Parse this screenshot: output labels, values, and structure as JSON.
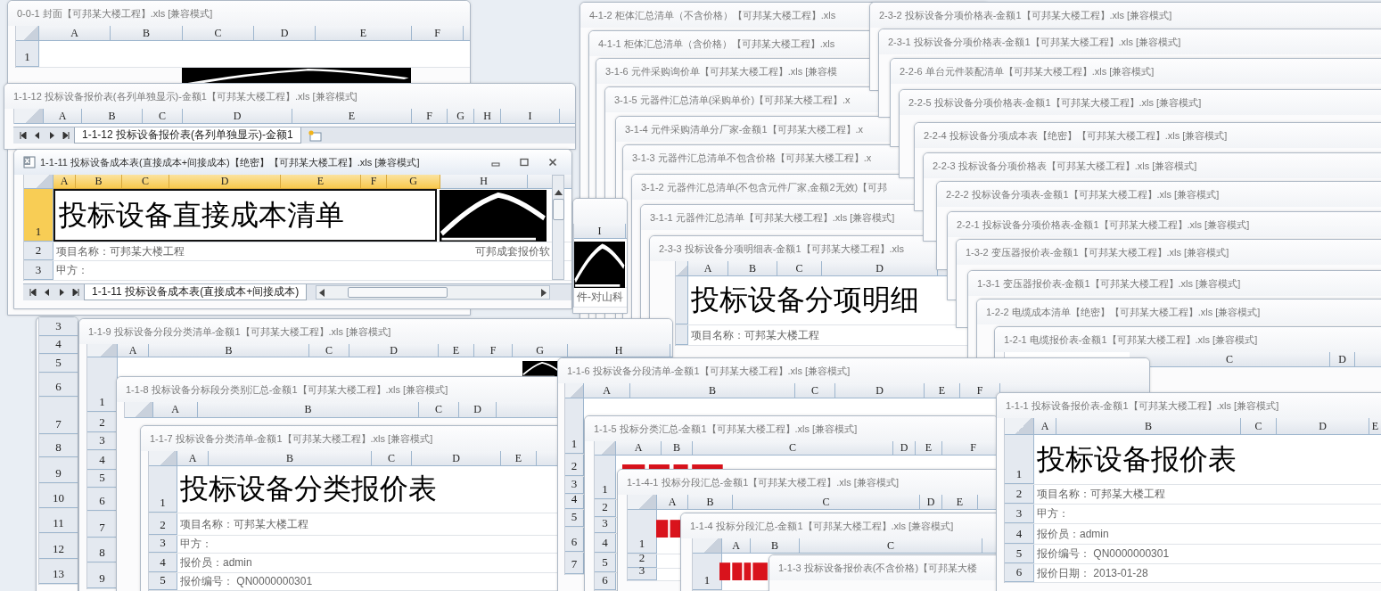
{
  "windows": [
    {
      "title": "4-1-2 柜体汇总清单（不含价格）【可邦某大楼工程】.xls",
      "active": false
    },
    {
      "title": "4-1-1 柜体汇总清单（含价格）【可邦某大楼工程】.xls",
      "active": false
    },
    {
      "title": "3-1-6 元件采购询价单【可邦某大楼工程】.xls  [兼容模",
      "active": false
    },
    {
      "title": "3-1-5 元器件汇总清单(采购单价)【可邦某大楼工程】.x",
      "active": false
    },
    {
      "title": "3-1-4 元件采购清单分厂家-金额1【可邦某大楼工程】.x",
      "active": false
    },
    {
      "title": "3-1-3 元器件汇总清单不包含价格【可邦某大楼工程】.x",
      "active": false
    },
    {
      "title": "3-1-2 元器件汇总清单(不包含元件厂家,金额2无效)【可邦",
      "active": false
    },
    {
      "title": "3-1-1 元器件汇总清单【可邦某大楼工程】.xls  [兼容模式]",
      "active": false
    },
    {
      "title": "2-3-3 投标设备分项明细表-金额1【可邦某大楼工程】.xls",
      "active": false,
      "columns": [
        {
          "label": "A"
        },
        {
          "label": "B"
        },
        {
          "label": "C"
        },
        {
          "label": "D"
        }
      ],
      "rows": [
        {
          "kind": "heading",
          "text": "投标设备分项明细"
        },
        {
          "kind": "info",
          "text": "项目名称：可邦某大楼工程"
        }
      ]
    },
    {
      "title": "2-3-2 投标设备分项价格表-金额1【可邦某大楼工程】.xls  [兼容模式]",
      "active": false
    },
    {
      "title": "2-3-1 投标设备分项价格表-金额1【可邦某大楼工程】.xls  [兼容模式]",
      "active": false
    },
    {
      "title": "2-2-6 单台元件装配清单【可邦某大楼工程】.xls  [兼容模式]",
      "active": false
    },
    {
      "title": "2-2-5 投标设备分项价格表-金额1【可邦某大楼工程】.xls  [兼容模式]",
      "active": false
    },
    {
      "title": "2-2-4 投标设备分项成本表【绝密】【可邦某大楼工程】.xls  [兼容模式]",
      "active": false
    },
    {
      "title": "2-2-3 投标设备分项价格表【可邦某大楼工程】.xls  [兼容模式]",
      "active": false
    },
    {
      "title": "2-2-2 投标设备分项表-金额1【可邦某大楼工程】.xls  [兼容模式]",
      "active": false
    },
    {
      "title": "2-2-1 投标设备分项价格表-金额1【可邦某大楼工程】.xls  [兼容模式]",
      "active": false
    },
    {
      "title": "1-3-2 变压器报价表-金额1【可邦某大楼工程】.xls  [兼容模式]",
      "active": false
    },
    {
      "title": "1-3-1 变压器报价表-金额1【可邦某大楼工程】.xls  [兼容模式]",
      "active": false
    },
    {
      "title": "1-2-2 电缆成本清单【绝密】【可邦某大楼工程】.xls  [兼容模式]",
      "active": false
    },
    {
      "title": "1-2-1 电缆报价表-金额1【可邦某大楼工程】.xls  [兼容模式]",
      "active": false,
      "columns": [
        {
          "label": "C"
        },
        {
          "label": "D"
        }
      ]
    },
    {
      "active": false,
      "rows": [
        {
          "kind": "blank",
          "number": "3"
        },
        {
          "kind": "blank",
          "number": "4"
        },
        {
          "kind": "blank",
          "number": "5"
        },
        {
          "kind": "blank",
          "number": "6"
        },
        {
          "kind": "blank",
          "number": "7"
        },
        {
          "kind": "blank",
          "number": "8"
        },
        {
          "kind": "blank",
          "number": "9"
        },
        {
          "kind": "blank",
          "number": "10"
        },
        {
          "kind": "blank",
          "number": "11"
        },
        {
          "kind": "blank",
          "number": "12"
        },
        {
          "kind": "blank",
          "number": "13"
        }
      ]
    },
    {
      "title": "0-0-1 封面【可邦某大楼工程】.xls  [兼容模式]",
      "active": false,
      "logo": {
        "kind": "mountain"
      },
      "columns": [
        {
          "label": "A"
        },
        {
          "label": "B"
        },
        {
          "label": "C"
        },
        {
          "label": "D"
        },
        {
          "label": "E"
        },
        {
          "label": "F"
        }
      ],
      "rows": [
        {
          "kind": "blank",
          "number": "1"
        }
      ]
    },
    {
      "title": "1-1-12 投标设备报价表(各列单独显示)-金额1【可邦某大楼工程】.xls  [兼容模式]",
      "active": false,
      "columns": [
        {
          "label": "A"
        },
        {
          "label": "B"
        },
        {
          "label": "C"
        },
        {
          "label": "D"
        },
        {
          "label": "E"
        },
        {
          "label": "F"
        },
        {
          "label": "G"
        },
        {
          "label": "H"
        },
        {
          "label": "I"
        }
      ],
      "sheet_tab": "1-1-12  投标设备报价表(各列单独显示)-金额1"
    },
    {
      "title": "1-1-11 投标设备成本表(直接成本+间接成本)【绝密】【可邦某大楼工程】.xls  [兼容模式]",
      "active": true,
      "logo": {
        "kind": "mountain"
      },
      "columns": [
        {
          "label": "A",
          "selected": true
        },
        {
          "label": "B",
          "selected": true
        },
        {
          "label": "C",
          "selected": true
        },
        {
          "label": "D",
          "selected": true
        },
        {
          "label": "E",
          "selected": true
        },
        {
          "label": "F",
          "selected": true
        },
        {
          "label": "G",
          "selected": true
        },
        {
          "label": "H",
          "selected": false
        }
      ],
      "rows": [
        {
          "kind": "heading",
          "number": "1",
          "text": "投标设备直接成本清单",
          "selected": true
        },
        {
          "kind": "info",
          "number": "2",
          "text": "项目名称：可邦某大楼工程",
          "right_text": "可邦成套报价软",
          "selected": false
        },
        {
          "kind": "info",
          "number": "3",
          "text": "甲方：",
          "selected": false
        }
      ],
      "sheet_tab": "1-1-11  投标设备成本表(直接成本+间接成本)"
    },
    {
      "active": false,
      "logo": {
        "kind": "mountain"
      },
      "columns": [
        {
          "label": "I"
        }
      ],
      "rows": [
        {
          "kind": "blank"
        },
        {
          "kind": "info",
          "text": "件-对山科"
        }
      ]
    },
    {
      "title": "1-1-9 投标设备分段分类清单-金额1【可邦某大楼工程】.xls  [兼容模式]",
      "active": false,
      "logo": {
        "kind": "mountain"
      },
      "columns": [
        {
          "label": "A"
        },
        {
          "label": "B"
        },
        {
          "label": "C"
        },
        {
          "label": "D"
        },
        {
          "label": "E"
        },
        {
          "label": "F"
        },
        {
          "label": "G"
        },
        {
          "label": "H"
        }
      ],
      "rows": [
        {
          "kind": "blank",
          "number": "1"
        },
        {
          "kind": "blank",
          "number": "2"
        },
        {
          "kind": "blank",
          "number": "3"
        },
        {
          "kind": "blank",
          "number": "4"
        },
        {
          "kind": "blank",
          "number": "5"
        },
        {
          "kind": "blank",
          "number": "6"
        },
        {
          "kind": "blank",
          "number": "7"
        },
        {
          "kind": "blank",
          "number": "8"
        },
        {
          "kind": "blank",
          "number": "9"
        }
      ]
    },
    {
      "title": "1-1-8 投标设备分标段分类别汇总-金额1【可邦某大楼工程】.xls  [兼容模式]",
      "active": false,
      "columns": [
        {
          "label": "A"
        },
        {
          "label": "B"
        },
        {
          "label": "C"
        },
        {
          "label": "D"
        }
      ]
    },
    {
      "title": "1-1-7 投标设备分类清单-金额1【可邦某大楼工程】.xls  [兼容模式]",
      "active": false,
      "columns": [
        {
          "label": "A"
        },
        {
          "label": "B"
        },
        {
          "label": "C"
        },
        {
          "label": "D"
        },
        {
          "label": "E"
        }
      ],
      "rows": [
        {
          "kind": "heading",
          "number": "1",
          "text": "投标设备分类报价表"
        },
        {
          "kind": "info",
          "number": "2",
          "text": "项目名称：可邦某大楼工程"
        },
        {
          "kind": "info",
          "number": "3",
          "text": "甲方："
        },
        {
          "kind": "info",
          "number": "4",
          "text": "报价员：admin"
        },
        {
          "kind": "info",
          "number": "5",
          "text": "报价编号： QN0000000301"
        }
      ]
    },
    {
      "title": "1-1-6 投标设备分段清单-金额1【可邦某大楼工程】.xls  [兼容模式]",
      "active": false,
      "columns": [
        {
          "label": "A"
        },
        {
          "label": "B"
        },
        {
          "label": "C"
        },
        {
          "label": "D"
        },
        {
          "label": "E"
        },
        {
          "label": "F"
        }
      ],
      "rows": [
        {
          "kind": "blank",
          "number": "1"
        },
        {
          "kind": "blank",
          "number": "2"
        },
        {
          "kind": "blank",
          "number": "3"
        },
        {
          "kind": "blank",
          "number": "4"
        },
        {
          "kind": "blank",
          "number": "5"
        },
        {
          "kind": "blank",
          "number": "6"
        },
        {
          "kind": "blank",
          "number": "7"
        }
      ]
    },
    {
      "title": "1-1-5 投标分类汇总-金额1【可邦某大楼工程】.xls  [兼容模式]",
      "active": false,
      "logo": {
        "kind": "brand"
      },
      "columns": [
        {
          "label": "A"
        },
        {
          "label": "B"
        },
        {
          "label": "C"
        },
        {
          "label": "D"
        },
        {
          "label": "E"
        },
        {
          "label": "F"
        }
      ],
      "rows": [
        {
          "kind": "blank",
          "number": "1"
        },
        {
          "kind": "blank",
          "number": "2"
        },
        {
          "kind": "blank",
          "number": "3"
        },
        {
          "kind": "blank",
          "number": "4"
        },
        {
          "kind": "blank",
          "number": "5"
        },
        {
          "kind": "blank",
          "number": "6"
        }
      ]
    },
    {
      "title": "1-1-4-1 投标分段汇总-金额1【可邦某大楼工程】.xls  [兼容模式]",
      "active": false,
      "logo": {
        "kind": "brand"
      },
      "columns": [
        {
          "label": "A"
        },
        {
          "label": "B"
        },
        {
          "label": "C"
        },
        {
          "label": "D"
        },
        {
          "label": "E"
        }
      ],
      "rows": [
        {
          "kind": "blank",
          "number": "1"
        },
        {
          "kind": "blank",
          "number": "2"
        },
        {
          "kind": "blank",
          "number": "3"
        }
      ]
    },
    {
      "title": "1-1-4 投标分段汇总-金额1【可邦某大楼工程】.xls  [兼容模式]",
      "active": false,
      "logo": {
        "kind": "brand"
      },
      "columns": [
        {
          "label": "A"
        },
        {
          "label": "B"
        },
        {
          "label": "C"
        }
      ],
      "rows": [
        {
          "kind": "blank",
          "number": "1"
        }
      ]
    },
    {
      "title": "1-1-3 投标设备报价表(不含价格)【可邦某大楼",
      "active": false
    },
    {
      "title": "1-1-1 投标设备报价表-金额1【可邦某大楼工程】.xls  [兼容模式]",
      "active": false,
      "columns": [
        {
          "label": "A"
        },
        {
          "label": "B"
        },
        {
          "label": "C"
        },
        {
          "label": "D"
        },
        {
          "label": "E"
        }
      ],
      "rows": [
        {
          "kind": "heading",
          "number": "1",
          "text": "投标设备报价表"
        },
        {
          "kind": "info",
          "number": "2",
          "text": "项目名称：可邦某大楼工程"
        },
        {
          "kind": "info",
          "number": "3",
          "text": "甲方："
        },
        {
          "kind": "info",
          "number": "4",
          "text": "报价员：admin"
        },
        {
          "kind": "info",
          "number": "5",
          "text": "报价编号： QN0000000301"
        },
        {
          "kind": "info",
          "number": "6",
          "text": "报价日期：  2013-01-28"
        }
      ]
    }
  ]
}
